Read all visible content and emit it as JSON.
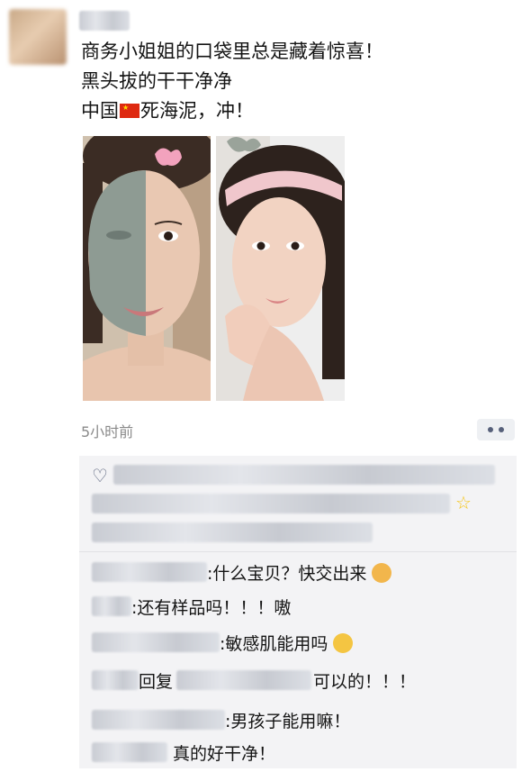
{
  "post": {
    "lines": [
      "商务小姐姐的口袋里总是藏着惊喜！",
      "黑头拔的干干净净",
      "中国",
      "死海泥，冲！"
    ],
    "time": "5小时前"
  },
  "comments": [
    {
      "text": ":什么宝贝？快交出来"
    },
    {
      "text": ":还有样品吗！！！嗷"
    },
    {
      "text": ":敏感肌能用吗"
    },
    {
      "reply": "回复",
      "text": "可以的！！！"
    },
    {
      "text": ":男孩子能用嘛！"
    },
    {
      "text": "真的好干净！"
    }
  ],
  "icons": {
    "like": "heart-icon",
    "more": "more-dots-icon",
    "flag": "china-flag-icon"
  },
  "colors": {
    "link": "#56607a",
    "panel": "#f3f3f5",
    "time": "#8a8a8a"
  }
}
